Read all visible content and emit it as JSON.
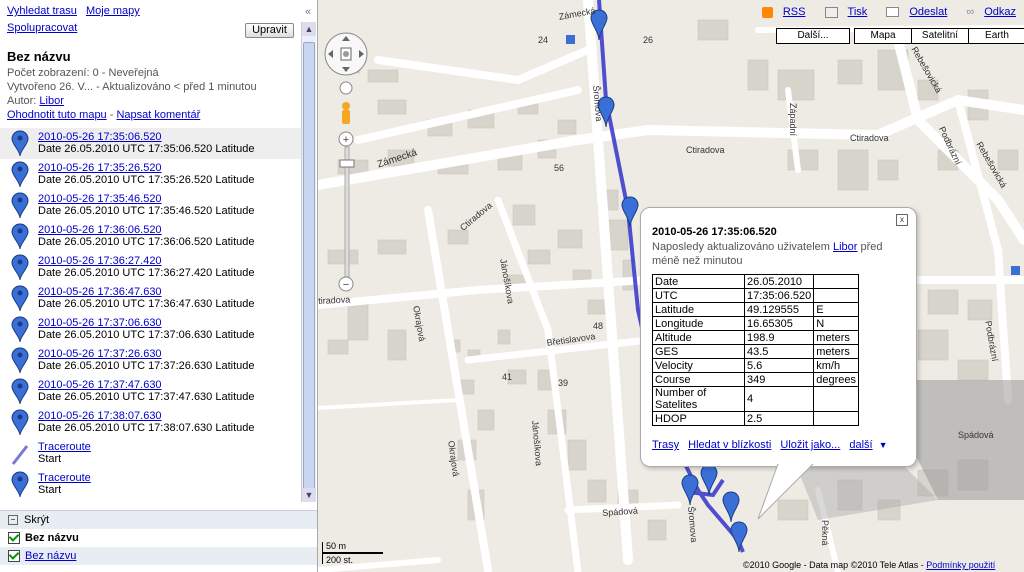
{
  "sidebar": {
    "nav": {
      "directions": "Vyhledat trasu",
      "my_maps": "Moje mapy"
    },
    "collaborate": "Spolupracovat",
    "edit_button": "Upravit",
    "collapse": "«",
    "title": "Bez názvu",
    "views": "Počet zobrazení: 0 - Neveřejná",
    "created": "Vytvořeno 26. V... - Aktualizováno < před 1 minutou",
    "author_label": "Autor:",
    "author": "Libor",
    "rate": "Ohodnotit tuto mapu",
    "sep": "-",
    "comment": "Napsat komentář",
    "items": [
      {
        "title": "2010-05-26 17:35:06.520",
        "desc": "Date 26.05.2010 UTC 17:35:06.520 Latitude",
        "kind": "pin"
      },
      {
        "title": "2010-05-26 17:35:26.520",
        "desc": "Date 26.05.2010 UTC 17:35:26.520 Latitude",
        "kind": "pin"
      },
      {
        "title": "2010-05-26 17:35:46.520",
        "desc": "Date 26.05.2010 UTC 17:35:46.520 Latitude",
        "kind": "pin"
      },
      {
        "title": "2010-05-26 17:36:06.520",
        "desc": "Date 26.05.2010 UTC 17:36:06.520 Latitude",
        "kind": "pin"
      },
      {
        "title": "2010-05-26 17:36:27.420",
        "desc": "Date 26.05.2010 UTC 17:36:27.420 Latitude",
        "kind": "pin"
      },
      {
        "title": "2010-05-26 17:36:47.630",
        "desc": "Date 26.05.2010 UTC 17:36:47.630 Latitude",
        "kind": "pin"
      },
      {
        "title": "2010-05-26 17:37:06.630",
        "desc": "Date 26.05.2010 UTC 17:37:06.630 Latitude",
        "kind": "pin"
      },
      {
        "title": "2010-05-26 17:37:26.630",
        "desc": "Date 26.05.2010 UTC 17:37:26.630 Latitude",
        "kind": "pin"
      },
      {
        "title": "2010-05-26 17:37:47.630",
        "desc": "Date 26.05.2010 UTC 17:37:47.630 Latitude",
        "kind": "pin"
      },
      {
        "title": "2010-05-26 17:38:07.630",
        "desc": "Date 26.05.2010 UTC 17:38:07.630 Latitude",
        "kind": "pin"
      },
      {
        "title": "Traceroute",
        "desc": "Start",
        "kind": "line"
      },
      {
        "title": "Traceroute",
        "desc": "Start",
        "kind": "pin"
      }
    ],
    "layers": {
      "hide": "Skrýt",
      "layer1": "Bez názvu",
      "layer2": "Bez názvu"
    }
  },
  "map": {
    "links": {
      "rss": "RSS",
      "print": "Tisk",
      "send": "Odeslat",
      "link": "Odkaz"
    },
    "types": [
      "Další...",
      "Mapa",
      "Satelitní",
      "Earth"
    ],
    "scale_m": "50 m",
    "scale_ft": "200 st.",
    "copyright": "©2010 Google - Data map ©2010 Tele Atlas -",
    "terms": "Podmínky použití",
    "streets": {
      "zamecka_top": "Zámecká",
      "zamecka": "Zámecká",
      "sromova": "Šromova",
      "sromova2": "Šromova",
      "ctiradova": "Ctiradova",
      "ctiradova2": "Ctiradova",
      "ctiradova3": "Ctiradova",
      "zapadni": "Západní",
      "rebesovicka": "Rebešovická",
      "rebesovicka2": "Rebešovická",
      "podbrazni": "Podbrázní",
      "podbrazni2": "Podbrázní",
      "janasikova": "Jánošíkova",
      "janasikova2": "Jánošíkova",
      "okrajova": "Okrajová",
      "okrajova2": "Okrajová",
      "tiradova": "tiradova",
      "bretislavova": "Břetislavova",
      "spadova": "Spádová",
      "spadova2": "Spádová",
      "pekna": "Pěkná",
      "n24": "24",
      "n56": "56",
      "n48": "48",
      "n41": "41",
      "n39": "39",
      "n26": "26"
    },
    "accent": "#3333cc"
  },
  "info": {
    "close": "x",
    "title": "2010-05-26 17:35:06.520",
    "updated_pre": "Naposledy aktualizováno uživatelem",
    "updated_user": "Libor",
    "updated_post": "před méně než minutou",
    "rows": [
      [
        "Date",
        "26.05.2010",
        ""
      ],
      [
        "UTC",
        "17:35:06.520",
        ""
      ],
      [
        "Latitude",
        "49.129555",
        "E"
      ],
      [
        "Longitude",
        "16.65305",
        "N"
      ],
      [
        "Altitude",
        "198.9",
        "meters"
      ],
      [
        "GES",
        "43.5",
        "meters"
      ],
      [
        "Velocity",
        "5.6",
        "km/h"
      ],
      [
        "Course",
        "349",
        "degrees"
      ],
      [
        "Number of Satelites",
        "4",
        ""
      ],
      [
        "HDOP",
        "2.5",
        ""
      ]
    ],
    "links": {
      "routes": "Trasy",
      "nearby": "Hledat v blízkosti",
      "save": "Uložit jako...",
      "more": "další"
    }
  }
}
